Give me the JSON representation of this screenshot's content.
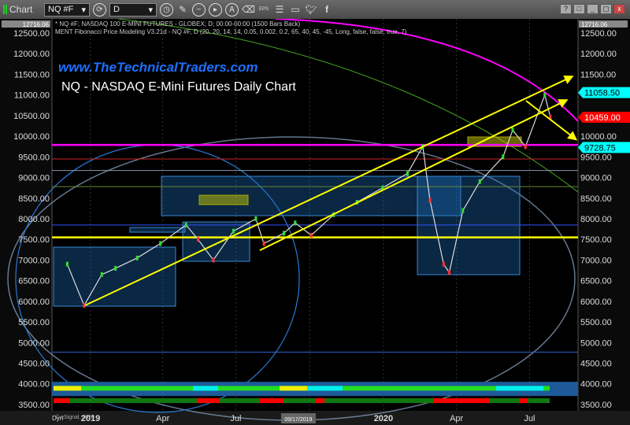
{
  "toolbar": {
    "title": "Chart",
    "symbol": "NQ #F",
    "interval": "D",
    "icons": [
      "link-icon",
      "clock-icon",
      "pencil-icon",
      "draw-icon",
      "play-icon",
      "text-icon",
      "eraser-icon",
      "eps-icon",
      "list-icon",
      "comment-icon",
      "twitter-icon",
      "facebook-icon"
    ],
    "eps": "EPS",
    "window_buttons": [
      "?",
      "□",
      "_",
      "▢",
      "x"
    ]
  },
  "header": {
    "line1": "* NQ #F; NASDAQ 100 E-MINI FUTURES - GLOBEX; D; 00:00-00:00 (1500 Bars Back)",
    "line2": "MENT Fibonacci Price Modeling V3.21d - NQ #F, D (20, 20, 14, 14, 0.05, 0.002, 0.2, 65, 40, 45, -45, Long, false, false, true, 7)",
    "top_price": "12716.06"
  },
  "watermark": {
    "url": "www.TheTechnicalTraders.com",
    "title": "NQ - NASDAQ E-Mini Futures Daily Chart"
  },
  "footer": {
    "copyright": "© eSignal, 2020",
    "dyn": "Dyn",
    "cursor_date": "09/17/2019"
  },
  "price_labels": [
    {
      "text": "11058.50",
      "value": 11058.5,
      "color": "#00ffff"
    },
    {
      "text": "10459.00",
      "value": 10459,
      "color": "#ff0000"
    },
    {
      "text": "9728.75",
      "value": 9728.75,
      "color": "#00ffff"
    }
  ],
  "colors": {
    "up": "#33dd33",
    "down": "#ff3333",
    "channel": "#ffff00",
    "magenta": "#ff00ff",
    "box": "#1e6fbf"
  },
  "chart_data": {
    "type": "line",
    "title": "NQ - NASDAQ E-Mini Futures Daily Chart",
    "ylim": [
      3500,
      12500
    ],
    "yticks": [
      12500,
      12000,
      11500,
      11000,
      10500,
      10000,
      9500,
      9000,
      8500,
      8000,
      7500,
      7000,
      6500,
      6000,
      5500,
      5000,
      4500,
      4000,
      3500
    ],
    "xticks": [
      {
        "date": "2019-01-01",
        "label": "2019"
      },
      {
        "date": "2019-04-01",
        "label": "Apr"
      },
      {
        "date": "2019-07-01",
        "label": "Jul"
      },
      {
        "date": "2019-10-01",
        "label": "t"
      },
      {
        "date": "2020-01-01",
        "label": "2020"
      },
      {
        "date": "2020-04-01",
        "label": "Apr"
      },
      {
        "date": "2020-07-01",
        "label": "Jul"
      }
    ],
    "grid": true,
    "series": [
      {
        "values": [
          [
            "2018-12-03",
            6900
          ],
          [
            "2018-12-24",
            5900
          ],
          [
            "2019-01-15",
            6650
          ],
          [
            "2019-02-01",
            6800
          ],
          [
            "2019-02-28",
            7050
          ],
          [
            "2019-03-29",
            7400
          ],
          [
            "2019-04-30",
            7850
          ],
          [
            "2019-05-15",
            7500
          ],
          [
            "2019-06-03",
            7000
          ],
          [
            "2019-06-28",
            7700
          ],
          [
            "2019-07-26",
            8000
          ],
          [
            "2019-08-05",
            7400
          ],
          [
            "2019-08-30",
            7650
          ],
          [
            "2019-09-13",
            7900
          ],
          [
            "2019-10-03",
            7600
          ],
          [
            "2019-10-31",
            8100
          ],
          [
            "2019-11-29",
            8400
          ],
          [
            "2019-12-31",
            8750
          ],
          [
            "2020-01-31",
            9100
          ],
          [
            "2020-02-19",
            9750
          ],
          [
            "2020-02-28",
            8450
          ],
          [
            "2020-03-16",
            6900
          ],
          [
            "2020-03-23",
            6700
          ],
          [
            "2020-04-09",
            8200
          ],
          [
            "2020-04-30",
            8900
          ],
          [
            "2020-05-29",
            9500
          ],
          [
            "2020-06-10",
            10150
          ],
          [
            "2020-06-26",
            9750
          ],
          [
            "2020-07-20",
            11000
          ],
          [
            "2020-07-27",
            10459
          ]
        ]
      }
    ],
    "horizontal_levels": [
      {
        "value": 9790,
        "color": "#ff00ff"
      },
      {
        "value": 7550,
        "color": "#ffff00"
      },
      {
        "value": 9450,
        "color": "#cc2222"
      },
      {
        "value": 7850,
        "color": "#3355ff"
      },
      {
        "value": 8780,
        "color": "#668833"
      },
      {
        "value": 9170,
        "color": "#8899aa"
      },
      {
        "value": 4770,
        "color": "#3366cc"
      }
    ]
  }
}
